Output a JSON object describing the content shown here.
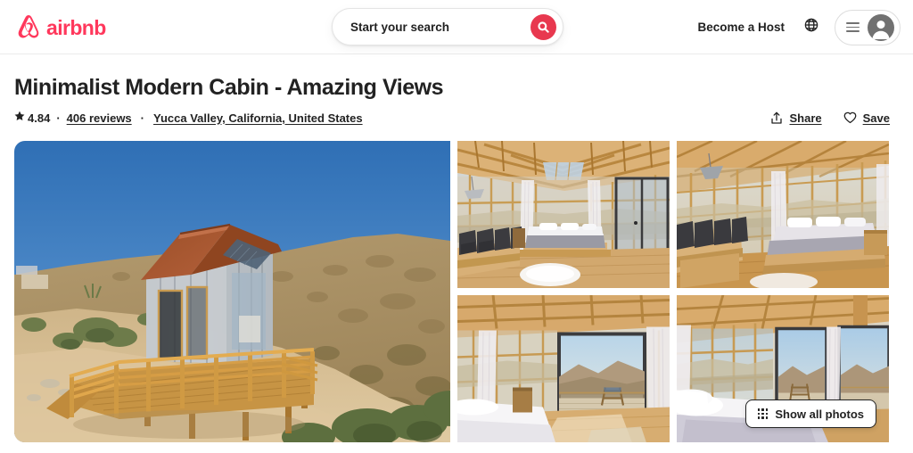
{
  "header": {
    "brand": "airbnb",
    "brand_color": "#FF385C",
    "logo_icon": "airbnb-belo-logo",
    "search": {
      "placeholder": "Start your search",
      "value": "",
      "button_icon": "search-icon",
      "button_color": "#E8384F"
    },
    "become_host_label": "Become a Host",
    "language_icon": "globe-icon",
    "menu_icon": "hamburger-icon",
    "avatar_icon": "user-avatar-icon"
  },
  "listing": {
    "title": "Minimalist Modern Cabin - Amazing Views",
    "rating_icon": "star-icon",
    "rating": "4.84",
    "separator": "·",
    "reviews_label": "406 reviews",
    "location": "Yucca Valley, California, United States",
    "share": {
      "icon": "share-icon",
      "label": "Share"
    },
    "save": {
      "icon": "heart-icon",
      "label": "Save"
    }
  },
  "gallery": {
    "show_all_photos": {
      "icon": "grid-dots-icon",
      "label": "Show all photos"
    },
    "photos": [
      {
        "name": "cabin-exterior-hillside",
        "alt": "Modern cabin with rust roof on desert hillside with wooden deck"
      },
      {
        "name": "interior-bedroom-truss-ceiling",
        "alt": "Interior with exposed wood trusses, bed and black cushioned bench"
      },
      {
        "name": "interior-bedroom-glass-wall",
        "alt": "Bedroom with floor to ceiling glass wall and bench seating"
      },
      {
        "name": "bedroom-view-to-deck",
        "alt": "View from bed through open door to deck and desert mountains"
      },
      {
        "name": "bedroom-desert-view",
        "alt": "Bed with white linens facing large windows with desert view"
      }
    ]
  }
}
